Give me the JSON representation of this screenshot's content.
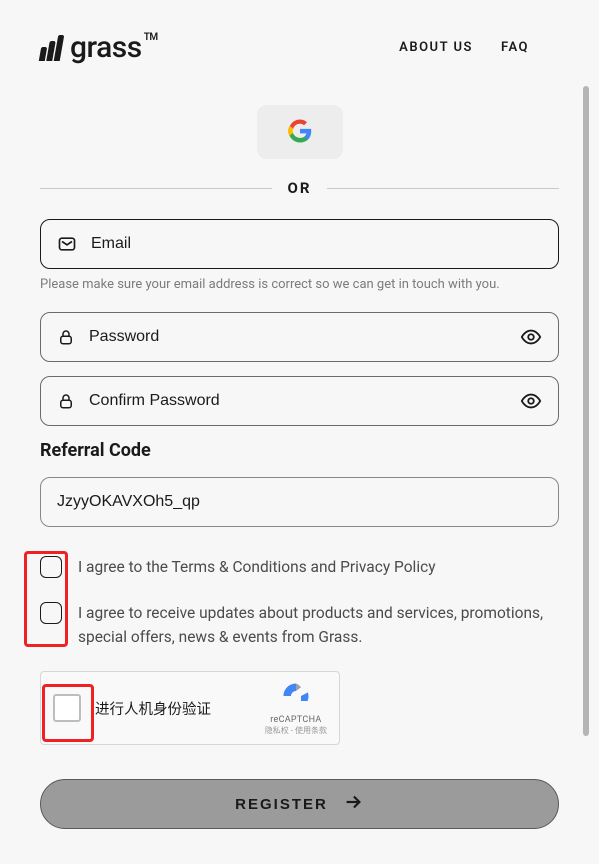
{
  "brand": {
    "name": "grass",
    "tm": "TM"
  },
  "nav": {
    "about": "ABOUT US",
    "faq": "FAQ"
  },
  "or_label": "OR",
  "fields": {
    "email_placeholder": "Email",
    "email_helper": "Please make sure your email address is correct so we can get in touch with you.",
    "password_placeholder": "Password",
    "confirm_placeholder": "Confirm Password"
  },
  "referral": {
    "label": "Referral Code",
    "value": "JzyyOKAVXOh5_qp"
  },
  "agreements": {
    "terms": "I agree to the Terms & Conditions and Privacy Policy",
    "marketing": "I agree to receive updates about products and services, promotions, special offers, news & events from Grass."
  },
  "recaptcha": {
    "text": "进行人机身份验证",
    "brand": "reCAPTCHA",
    "terms": "隐私权 - 使用条款"
  },
  "register_label": "REGISTER"
}
